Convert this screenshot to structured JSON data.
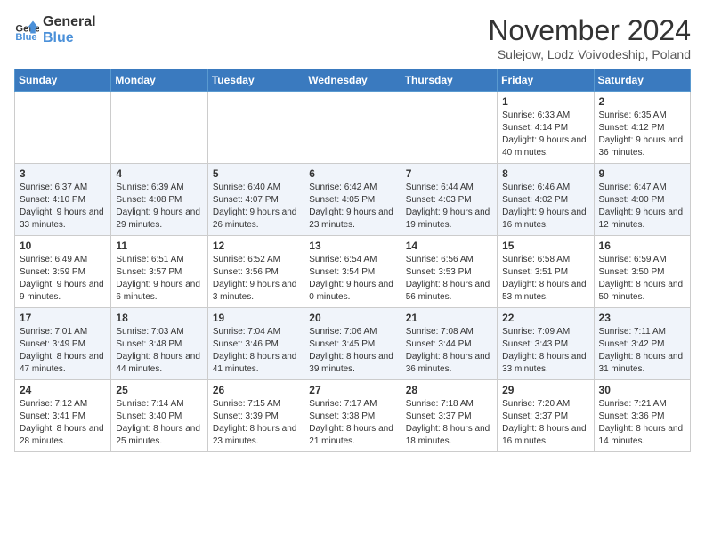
{
  "logo": {
    "line1": "General",
    "line2": "Blue"
  },
  "title": "November 2024",
  "subtitle": "Sulejow, Lodz Voivodeship, Poland",
  "days_of_week": [
    "Sunday",
    "Monday",
    "Tuesday",
    "Wednesday",
    "Thursday",
    "Friday",
    "Saturday"
  ],
  "weeks": [
    [
      {
        "day": "",
        "content": ""
      },
      {
        "day": "",
        "content": ""
      },
      {
        "day": "",
        "content": ""
      },
      {
        "day": "",
        "content": ""
      },
      {
        "day": "",
        "content": ""
      },
      {
        "day": "1",
        "content": "Sunrise: 6:33 AM\nSunset: 4:14 PM\nDaylight: 9 hours and 40 minutes."
      },
      {
        "day": "2",
        "content": "Sunrise: 6:35 AM\nSunset: 4:12 PM\nDaylight: 9 hours and 36 minutes."
      }
    ],
    [
      {
        "day": "3",
        "content": "Sunrise: 6:37 AM\nSunset: 4:10 PM\nDaylight: 9 hours and 33 minutes."
      },
      {
        "day": "4",
        "content": "Sunrise: 6:39 AM\nSunset: 4:08 PM\nDaylight: 9 hours and 29 minutes."
      },
      {
        "day": "5",
        "content": "Sunrise: 6:40 AM\nSunset: 4:07 PM\nDaylight: 9 hours and 26 minutes."
      },
      {
        "day": "6",
        "content": "Sunrise: 6:42 AM\nSunset: 4:05 PM\nDaylight: 9 hours and 23 minutes."
      },
      {
        "day": "7",
        "content": "Sunrise: 6:44 AM\nSunset: 4:03 PM\nDaylight: 9 hours and 19 minutes."
      },
      {
        "day": "8",
        "content": "Sunrise: 6:46 AM\nSunset: 4:02 PM\nDaylight: 9 hours and 16 minutes."
      },
      {
        "day": "9",
        "content": "Sunrise: 6:47 AM\nSunset: 4:00 PM\nDaylight: 9 hours and 12 minutes."
      }
    ],
    [
      {
        "day": "10",
        "content": "Sunrise: 6:49 AM\nSunset: 3:59 PM\nDaylight: 9 hours and 9 minutes."
      },
      {
        "day": "11",
        "content": "Sunrise: 6:51 AM\nSunset: 3:57 PM\nDaylight: 9 hours and 6 minutes."
      },
      {
        "day": "12",
        "content": "Sunrise: 6:52 AM\nSunset: 3:56 PM\nDaylight: 9 hours and 3 minutes."
      },
      {
        "day": "13",
        "content": "Sunrise: 6:54 AM\nSunset: 3:54 PM\nDaylight: 9 hours and 0 minutes."
      },
      {
        "day": "14",
        "content": "Sunrise: 6:56 AM\nSunset: 3:53 PM\nDaylight: 8 hours and 56 minutes."
      },
      {
        "day": "15",
        "content": "Sunrise: 6:58 AM\nSunset: 3:51 PM\nDaylight: 8 hours and 53 minutes."
      },
      {
        "day": "16",
        "content": "Sunrise: 6:59 AM\nSunset: 3:50 PM\nDaylight: 8 hours and 50 minutes."
      }
    ],
    [
      {
        "day": "17",
        "content": "Sunrise: 7:01 AM\nSunset: 3:49 PM\nDaylight: 8 hours and 47 minutes."
      },
      {
        "day": "18",
        "content": "Sunrise: 7:03 AM\nSunset: 3:48 PM\nDaylight: 8 hours and 44 minutes."
      },
      {
        "day": "19",
        "content": "Sunrise: 7:04 AM\nSunset: 3:46 PM\nDaylight: 8 hours and 41 minutes."
      },
      {
        "day": "20",
        "content": "Sunrise: 7:06 AM\nSunset: 3:45 PM\nDaylight: 8 hours and 39 minutes."
      },
      {
        "day": "21",
        "content": "Sunrise: 7:08 AM\nSunset: 3:44 PM\nDaylight: 8 hours and 36 minutes."
      },
      {
        "day": "22",
        "content": "Sunrise: 7:09 AM\nSunset: 3:43 PM\nDaylight: 8 hours and 33 minutes."
      },
      {
        "day": "23",
        "content": "Sunrise: 7:11 AM\nSunset: 3:42 PM\nDaylight: 8 hours and 31 minutes."
      }
    ],
    [
      {
        "day": "24",
        "content": "Sunrise: 7:12 AM\nSunset: 3:41 PM\nDaylight: 8 hours and 28 minutes."
      },
      {
        "day": "25",
        "content": "Sunrise: 7:14 AM\nSunset: 3:40 PM\nDaylight: 8 hours and 25 minutes."
      },
      {
        "day": "26",
        "content": "Sunrise: 7:15 AM\nSunset: 3:39 PM\nDaylight: 8 hours and 23 minutes."
      },
      {
        "day": "27",
        "content": "Sunrise: 7:17 AM\nSunset: 3:38 PM\nDaylight: 8 hours and 21 minutes."
      },
      {
        "day": "28",
        "content": "Sunrise: 7:18 AM\nSunset: 3:37 PM\nDaylight: 8 hours and 18 minutes."
      },
      {
        "day": "29",
        "content": "Sunrise: 7:20 AM\nSunset: 3:37 PM\nDaylight: 8 hours and 16 minutes."
      },
      {
        "day": "30",
        "content": "Sunrise: 7:21 AM\nSunset: 3:36 PM\nDaylight: 8 hours and 14 minutes."
      }
    ]
  ]
}
